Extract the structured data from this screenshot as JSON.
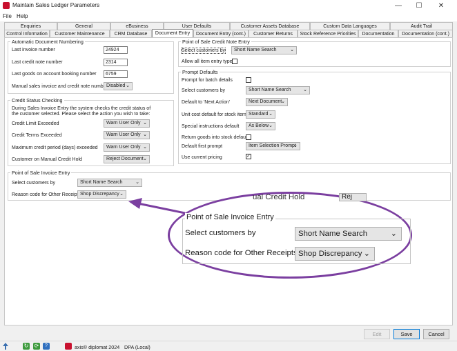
{
  "window": {
    "title": "Maintain Sales Ledger Parameters",
    "min": "—",
    "max": "☐",
    "close": "✕"
  },
  "menu": [
    "File",
    "Help"
  ],
  "tabs_row1": [
    "Enquiries",
    "General",
    "eBusiness",
    "User Defaults",
    "Customer Assets Database",
    "Custom Data Languages",
    "Audit Trail"
  ],
  "tabs_row2": [
    "Control Information",
    "Customer Maintenance",
    "CRM Database",
    "Document Entry",
    "Document Entry (cont.)",
    "Customer Returns",
    "Stock Reference Priorities",
    "Documentation",
    "Documentation (cont.)"
  ],
  "auto_numbering": {
    "title": "Automatic Document Numbering",
    "last_invoice_label": "Last invoice number",
    "last_invoice": "24924",
    "last_credit_label": "Last credit note number",
    "last_credit": "2314",
    "last_goods_label": "Last goods on account booking number",
    "last_goods": "6759",
    "manual_label": "Manual sales invoice and credit note numbers",
    "manual_value": "Disabled"
  },
  "credit_status": {
    "title": "Credit Status Checking",
    "intro1": "During Sales Invoice Entry the system checks the credit status of",
    "intro2": "the customer selected. Please select the action you wish to take:",
    "limit_label": "Credit Limit Exceeded",
    "limit_value": "Warn User Only",
    "terms_label": "Credit Terms Exceeded",
    "terms_value": "Warn User Only",
    "period_label": "Maximum credit period (days) exceeded",
    "period_value": "Warn User Only",
    "hold_label": "Customer on Manual Credit Hold",
    "hold_value": "Reject Document"
  },
  "pos_credit": {
    "title": "Point of Sale Credit Note Entry",
    "select_label": "Select customers by",
    "select_value": "Short Name Search",
    "allow_label": "Allow all item entry types"
  },
  "prompt_defaults": {
    "title": "Prompt Defaults",
    "batch_label": "Prompt for batch details",
    "select_label": "Select customers by",
    "select_value": "Short Name Search",
    "next_label": "Default to 'Next Action'",
    "next_value": "Next Document",
    "unit_label": "Unit cost default for stock items",
    "unit_value": "Standard",
    "special_label": "Special instructions default",
    "special_value": "As Below",
    "return_label": "Return goods into stock default",
    "first_label": "Default first prompt",
    "first_value": "Item Selection Prompt",
    "pricing_label": "Use current pricing"
  },
  "pos_invoice": {
    "title": "Point of Sale Invoice Entry",
    "select_label": "Select customers by",
    "select_value": "Short Name Search",
    "reason_label": "Reason code for Other Receipts",
    "reason_value": "Shop Discrepancy"
  },
  "zoom": {
    "peek_label": "ual Credit Hold",
    "peek_value": "Rej"
  },
  "buttons": {
    "edit": "Edit",
    "save": "Save",
    "cancel": "Cancel"
  },
  "status": {
    "product": "axis® diplomat 2024",
    "db": "DPA (Local)"
  },
  "colors": {
    "callout": "#7b3fa0",
    "accent": "#0078d7"
  }
}
